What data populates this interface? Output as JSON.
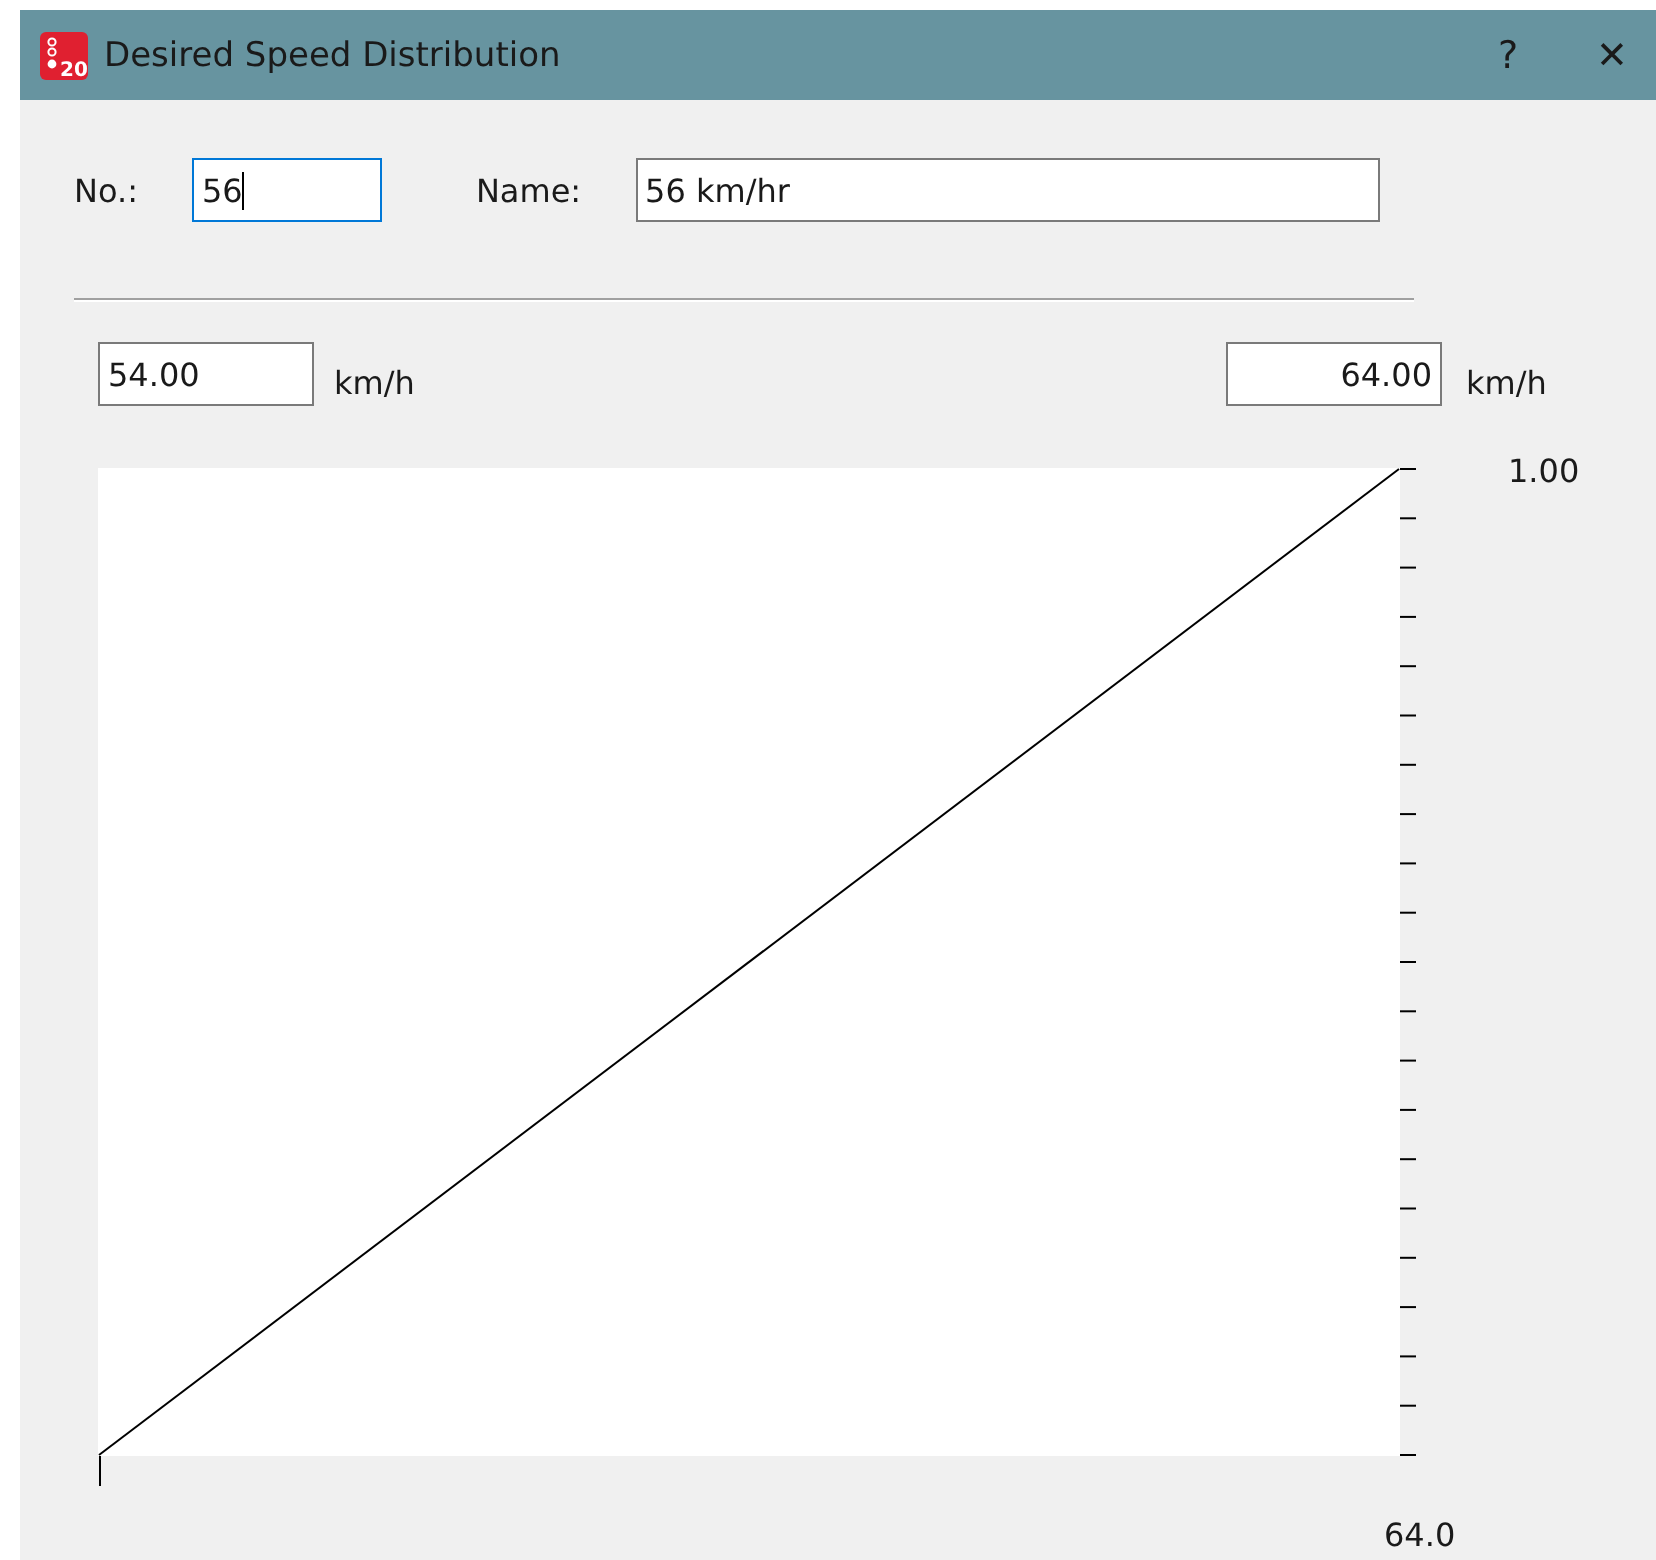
{
  "window": {
    "title": "Desired Speed Distribution",
    "icon_badge": "20",
    "title_buttons": [
      {
        "kind": "help",
        "label": "?"
      },
      {
        "kind": "close",
        "label": "✕"
      }
    ]
  },
  "number": {
    "label": "No.:",
    "value": "56",
    "focused": true
  },
  "name": {
    "label": "Name:",
    "value": "56 km/hr",
    "focused": false
  },
  "range": {
    "min": {
      "value": "54.00",
      "unit": "km/h"
    },
    "max": {
      "value": "64.00",
      "unit": "km/h"
    }
  },
  "chart": {
    "y_max_label": "1.00",
    "x_max_label": "64.0"
  }
}
